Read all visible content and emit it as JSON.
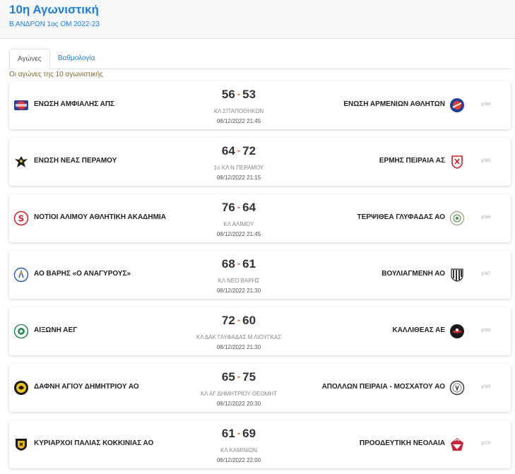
{
  "header": {
    "title": "10η Αγωνιστική",
    "subtitle": "Β ΑΝΔΡΩΝ 1ος ΟΜ 2022-23"
  },
  "tabs": [
    {
      "label": "Αγώνες"
    },
    {
      "label": "Βαθμολογία"
    }
  ],
  "round_label": "Οι αγώνες της 10 αγωνιστικής",
  "colors": {
    "accent": "#1e7fd6",
    "score_separator": "#e05a2a"
  },
  "matches": [
    {
      "home": "ΕΝΩΣΗ ΑΜΦΙΑΛΗΣ ΑΠΣ",
      "home_logo": "amfiali-logo",
      "home_score": "56",
      "separator": "-",
      "away_score": "53",
      "away": "ΕΝΩΣΗ ΑΡΜΕΝΙΩΝ ΑΘΛΗΤΩΝ",
      "away_logo": "armenion-logo",
      "venue": "ΚΛ ΣΙΤΑΠΟΘΗΚΩΝ",
      "date": "08/12/2022 21:45",
      "code": "g064"
    },
    {
      "home": "ΕΝΩΣΗ ΝΕΑΣ ΠΕΡΑΜΟΥ",
      "home_logo": "eagle-logo",
      "home_score": "64",
      "separator": "-",
      "away_score": "72",
      "away": "ΕΡΜΗΣ ΠΕΙΡΑΙΑ ΑΣ",
      "away_logo": "ermis-logo",
      "venue": "1ο ΚΛ Ν ΠΕΡΑΜΟΥ",
      "date": "08/12/2022 21:15",
      "code": "g065"
    },
    {
      "home": "ΝΟΤΙΟΙ ΑΛΙΜΟΥ ΑΘΛΗΤΙΚΗ ΑΚΑΔΗΜΙΑ",
      "home_logo": "notioi-logo",
      "home_score": "76",
      "separator": "-",
      "away_score": "64",
      "away": "ΤΕΡΨΙΘΕΑ ΓΛΥΦΑΔΑΣ ΑΟ",
      "away_logo": "terpsithea-logo",
      "venue": "ΚΛ ΑΛΙΜΟΥ",
      "date": "08/12/2022 21:45",
      "code": "g066"
    },
    {
      "home": "ΑΟ ΒΑΡΗΣ «Ο ΑΝΑΓΥΡΟΥΣ»",
      "home_logo": "varis-logo",
      "home_score": "68",
      "separator": "-",
      "away_score": "61",
      "away": "ΒΟΥΛΙΑΓΜΕΝΗ ΑΟ",
      "away_logo": "vouliagmeni-logo",
      "venue": "ΚΛ ΝΕΟ ΒΑΡΗΣ",
      "date": "08/12/2022 21:30",
      "code": "g067"
    },
    {
      "home": "ΑΙΞΩΝΗ ΑΕΓ",
      "home_logo": "aixoni-logo",
      "home_score": "72",
      "separator": "-",
      "away_score": "60",
      "away": "ΚΑΛΛΙΘΕΑΣ ΑΕ",
      "away_logo": "kallithea-logo",
      "venue": "ΚΛ ΔΑΚ ΓΛΥΦΑΔΑΣ Μ ΛΙΟΥΓΚΑΣ",
      "date": "08/12/2022 21:30",
      "code": "g068"
    },
    {
      "home": "ΔΑΦΝΗ ΑΓΙΟΥ ΔΗΜΗΤΡΙΟΥ ΑΟ",
      "home_logo": "dafni-logo",
      "home_score": "65",
      "separator": "-",
      "away_score": "75",
      "away": "ΑΠΟΛΛΩΝ ΠΕΙΡΑΙΑ - ΜΟΣΧΑΤΟΥ ΑΟ",
      "away_logo": "apollon-logo",
      "venue": "ΚΛ ΑΓ ΔΗΜΗΤΡΙΟΥ ΘΕΟΜΗΤ",
      "date": "08/12/2022 20:30",
      "code": "g069"
    },
    {
      "home": "ΚΥΡΙΑΡΧΟΙ ΠΑΛΙΑΣ ΚΟΚΚΙΝΙΑΣ ΑΟ",
      "home_logo": "kyriarxoi-logo",
      "home_score": "61",
      "separator": "-",
      "away_score": "69",
      "away": "ΠΡΟΟΔΕΥΤΙΚΗ ΝΕΟΛΑΙΑ",
      "away_logo": "proodeftiki-logo",
      "venue": "ΚΛ ΚΑΜΙΝΙΩΝ",
      "date": "08/12/2022 22:00",
      "code": "g070"
    }
  ]
}
